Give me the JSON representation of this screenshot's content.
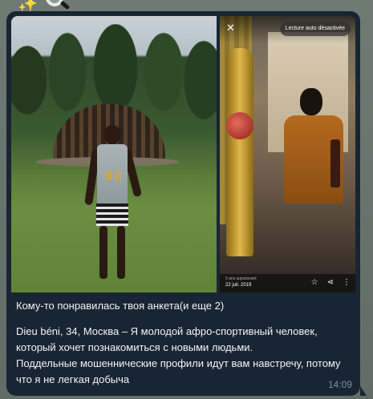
{
  "header_emoji": {
    "sparkles": "✨",
    "magnifier_icon": "magnifier-icon"
  },
  "message": {
    "gallery": {
      "left_photo": {
        "description_icon": "profile-photo",
        "shirt_number": "92"
      },
      "right_photo": {
        "close_label": "✕",
        "autoplay_label": "Lecture auto désactivée",
        "time_ago": "5 ans auparavant",
        "date": "22 juil. 2019",
        "icons": [
          "star-icon",
          "share-icon",
          "more-icon"
        ]
      }
    },
    "text": {
      "line1": "Кому-то понравилась твоя анкета(и еще 2)",
      "profile": "Dieu béni, 34, Москва – Я молодой афро-спортивный человек, который хочет познакомиться с новыми людьми.",
      "warning": "Поддельные мошеннические профили идут вам навстречу, потому что я не легкая добыча"
    },
    "time": "14:09"
  },
  "colors": {
    "bubble": "#182533",
    "text": "#f5f5f5",
    "time": "#7e8e9c"
  }
}
